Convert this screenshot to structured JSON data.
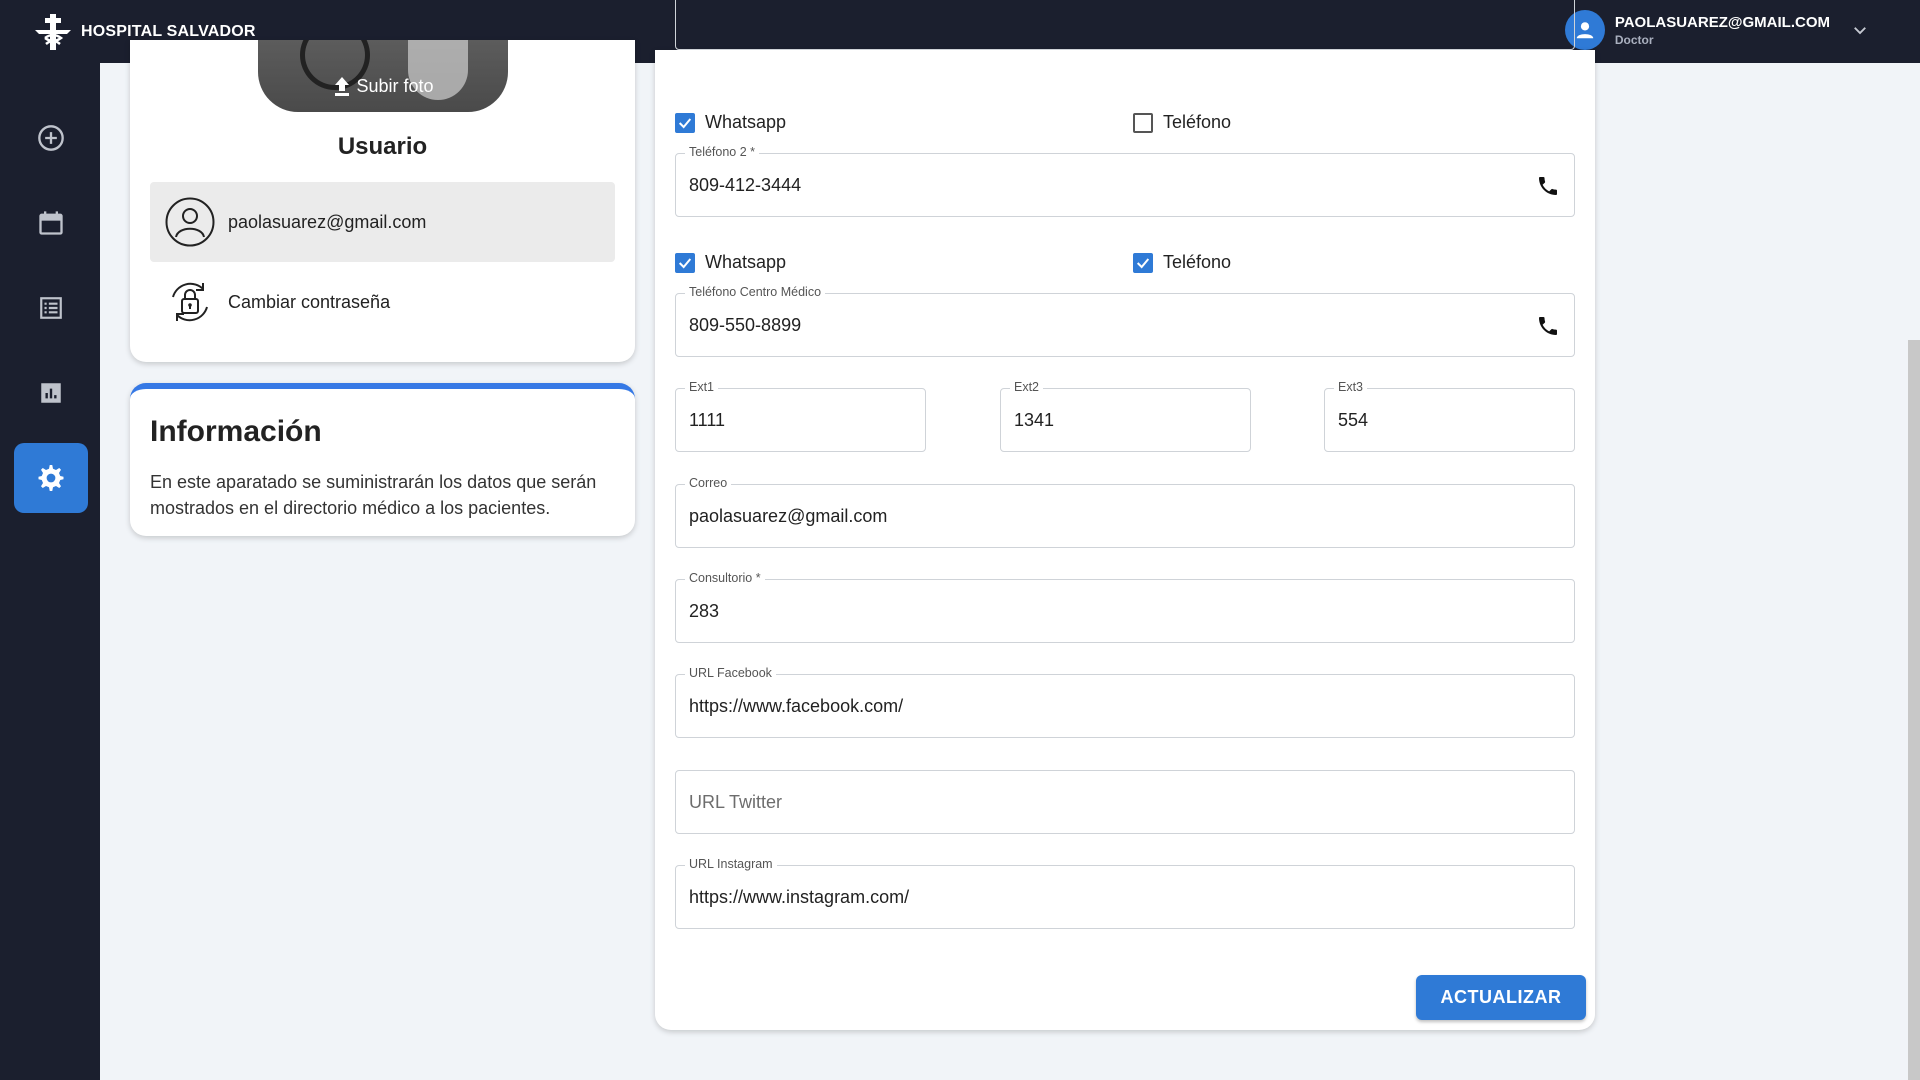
{
  "brand": {
    "name": "HOSPITAL SALVADOR"
  },
  "user": {
    "email": "PAOLASUAREZ@GMAIL.COM",
    "role": "Doctor"
  },
  "sidebar": {
    "items": [
      {
        "icon": "plus-circle-icon"
      },
      {
        "icon": "calendar-icon"
      },
      {
        "icon": "list-icon"
      },
      {
        "icon": "chart-icon"
      },
      {
        "icon": "gear-icon",
        "active": true
      }
    ]
  },
  "profile": {
    "upload_label": "Subir foto",
    "name": "Usuario",
    "menu": [
      {
        "label": "paolasuarez@gmail.com",
        "icon": "user-icon",
        "selected": true
      },
      {
        "label": "Cambiar contraseña",
        "icon": "lock-refresh-icon",
        "selected": false
      }
    ]
  },
  "info": {
    "title": "Información",
    "text": "En este aparatado se suministrarán los datos que serán mostrados en el directorio médico a los pacientes."
  },
  "form": {
    "checks1": {
      "whatsapp": "Whatsapp",
      "whatsapp_on": true,
      "telefono": "Teléfono",
      "telefono_on": false
    },
    "telefono2": {
      "label": "Teléfono 2 *",
      "value": "809-412-3444"
    },
    "checks2": {
      "whatsapp": "Whatsapp",
      "whatsapp_on": true,
      "telefono": "Teléfono",
      "telefono_on": true
    },
    "telefono_centro": {
      "label": "Teléfono Centro Médico",
      "value": "809-550-8899"
    },
    "ext1": {
      "label": "Ext1",
      "value": "1111"
    },
    "ext2": {
      "label": "Ext2",
      "value": "1341"
    },
    "ext3": {
      "label": "Ext3",
      "value": "554"
    },
    "correo": {
      "label": "Correo",
      "value": "paolasuarez@gmail.com"
    },
    "consultorio": {
      "label": "Consultorio *",
      "value": "283"
    },
    "facebook": {
      "label": "URL Facebook",
      "value": "https://www.facebook.com/"
    },
    "twitter": {
      "placeholder": "URL Twitter"
    },
    "instagram": {
      "label": "URL Instagram",
      "value": "https://www.instagram.com/"
    },
    "submit": "ACTUALIZAR"
  },
  "colors": {
    "accent": "#2f7ad6",
    "topbar": "#1b1f2e",
    "info_border": "#3578e5"
  }
}
